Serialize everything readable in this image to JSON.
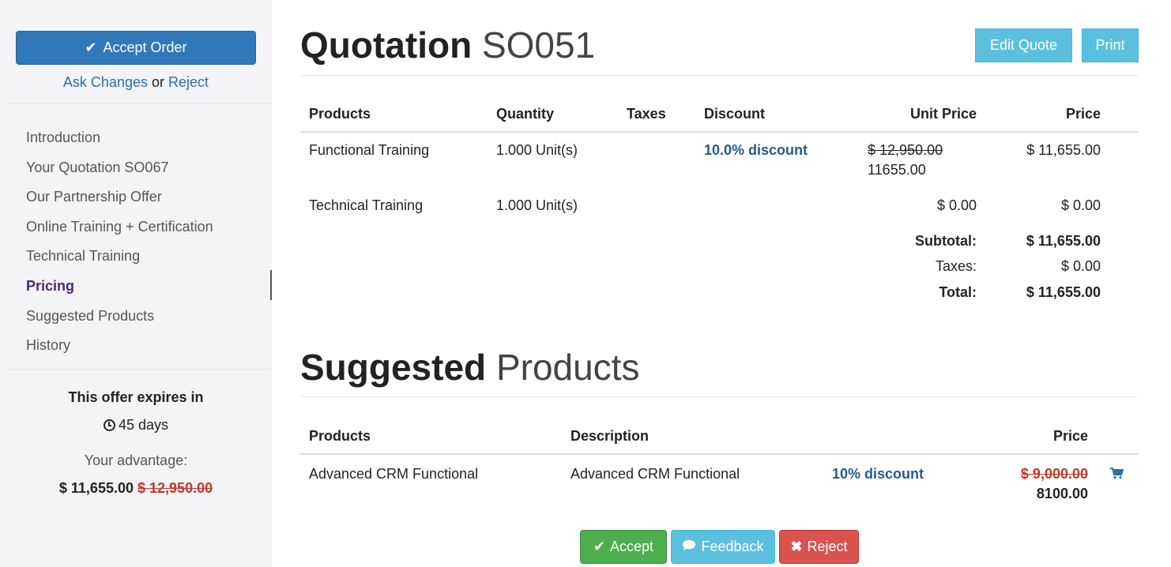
{
  "sidebar": {
    "accept_order_label": "Accept Order",
    "ask_changes": "Ask Changes",
    "or": "or",
    "reject": "Reject",
    "nav": [
      {
        "label": "Introduction"
      },
      {
        "label": "Your Quotation SO067"
      },
      {
        "label": "Our Partnership Offer"
      },
      {
        "label": "Online Training + Certification"
      },
      {
        "label": "Technical Training"
      },
      {
        "label": "Pricing",
        "active": true
      },
      {
        "label": "Suggested Products"
      },
      {
        "label": "History"
      }
    ],
    "expires_title": "This offer expires in",
    "expires_days": "45 days",
    "advantage_label": "Your advantage:",
    "advantage_price": "$ 11,655.00",
    "advantage_old_price": "$ 12,950.00"
  },
  "quotation": {
    "title_bold": "Quotation",
    "title_number": "SO051",
    "edit_label": "Edit Quote",
    "print_label": "Print",
    "headers": {
      "products": "Products",
      "quantity": "Quantity",
      "taxes": "Taxes",
      "discount": "Discount",
      "unit_price": "Unit Price",
      "price": "Price"
    },
    "rows": [
      {
        "product": "Functional Training",
        "quantity": "1.000 Unit(s)",
        "discount": "10.0% discount",
        "unit_price_old": "$ 12,950.00",
        "unit_price": "11655.00",
        "price": "$ 11,655.00"
      },
      {
        "product": "Technical Training",
        "quantity": "1.000 Unit(s)",
        "discount": "",
        "unit_price": "$ 0.00",
        "price": "$ 0.00"
      }
    ],
    "totals": {
      "subtotal_label": "Subtotal:",
      "subtotal": "$ 11,655.00",
      "taxes_label": "Taxes:",
      "taxes": "$ 0.00",
      "total_label": "Total:",
      "total": "$ 11,655.00"
    }
  },
  "suggested": {
    "title_bold": "Suggested",
    "title_rest": "Products",
    "headers": {
      "products": "Products",
      "description": "Description",
      "price": "Price"
    },
    "rows": [
      {
        "product": "Advanced CRM Functional",
        "description": "Advanced CRM Functional",
        "discount": "10% discount",
        "price_old": "$ 9,000.00",
        "price": "8100.00"
      }
    ]
  },
  "actions": {
    "accept": "Accept",
    "feedback": "Feedback",
    "reject": "Reject"
  }
}
